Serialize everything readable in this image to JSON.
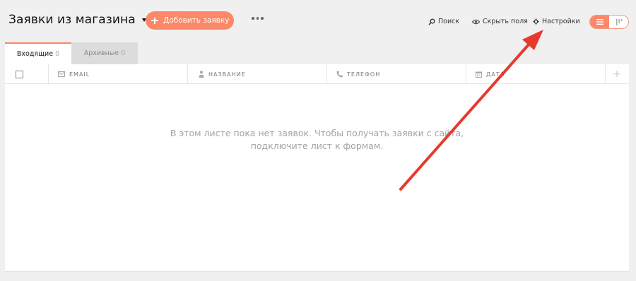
{
  "header": {
    "title": "Заявки из магазина",
    "add_button": "Добовить заявку",
    "tools": {
      "search": "Поиск",
      "hide_fields": "Скрыть поля",
      "settings": "Настройки"
    },
    "view_toggle": {
      "active": "list-view",
      "inactive": "kanban-view"
    }
  },
  "tabs": [
    {
      "label": "Входящие",
      "count": "0"
    },
    {
      "label": "Архивные",
      "count": "0"
    }
  ],
  "table": {
    "columns": [
      {
        "label": "EMAIL",
        "icon": "mail-icon"
      },
      {
        "label": "НАЗВАНИЕ",
        "icon": "person-icon"
      },
      {
        "label": "ТЕЛЕФОН",
        "icon": "phone-icon"
      },
      {
        "label": "ДАТА",
        "icon": "calendar-icon"
      }
    ],
    "add_column": "+"
  },
  "empty_state": {
    "line1": "В этом листе пока нет заявок. Чтобы получать заявки с сайта,",
    "line2": "подключите лист к формам."
  },
  "colors": {
    "accent": "#fa8869",
    "annotation_arrow": "#e53a2c",
    "background": "#f0f0f0"
  }
}
